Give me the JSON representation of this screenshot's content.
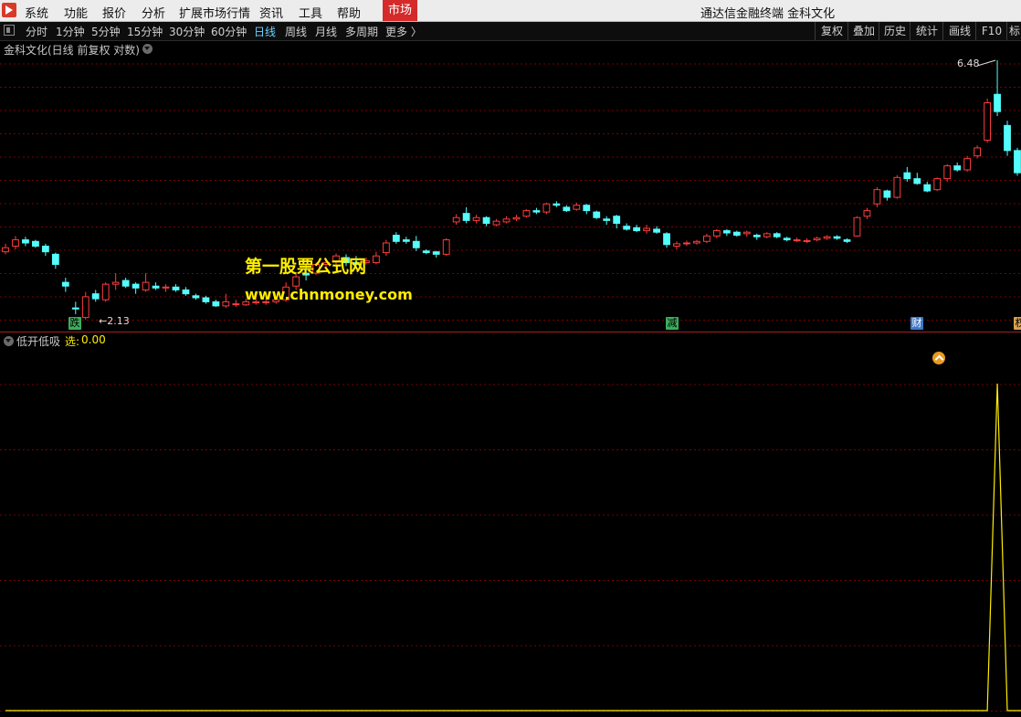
{
  "menu": {
    "items": [
      "系统",
      "功能",
      "报价",
      "分析",
      "扩展市场行情",
      "资讯",
      "工具",
      "帮助"
    ],
    "market_label": "市场",
    "window_title": "通达信金融终端 金科文化"
  },
  "toolbar": {
    "periods": [
      "分时",
      "1分钟",
      "5分钟",
      "15分钟",
      "30分钟",
      "60分钟",
      "日线",
      "周线",
      "月线",
      "多周期",
      "更多 〉"
    ],
    "active_period": "日线",
    "right_buttons": [
      "复权",
      "叠加",
      "历史",
      "统计",
      "画线",
      "F10",
      "标"
    ]
  },
  "chart": {
    "title": "金科文化(日线 前复权 对数)",
    "high_label": "6.48",
    "low_label": "←2.13",
    "event_tags": [
      "跌",
      "减",
      "财",
      "权"
    ],
    "watermark_line1": "第一股票公式网",
    "watermark_line2": "www.chnmoney.com",
    "colors": {
      "up": "#ff3c3c",
      "down": "#54fcfc",
      "grid": "#7a0000",
      "indicator": "#ffee00"
    }
  },
  "indicator": {
    "name": "低开低吸",
    "key": "选:",
    "value": "0.00"
  },
  "chart_data": {
    "type": "candlestick",
    "high": 6.48,
    "low": 2.13,
    "candles": [
      [
        2.85,
        2.9,
        2.82,
        2.95
      ],
      [
        2.92,
        3.0,
        2.88,
        3.05
      ],
      [
        3.0,
        2.96,
        2.92,
        3.04
      ],
      [
        2.98,
        2.92,
        2.9,
        3.0
      ],
      [
        2.92,
        2.85,
        2.8,
        2.95
      ],
      [
        2.82,
        2.7,
        2.65,
        2.84
      ],
      [
        2.5,
        2.46,
        2.4,
        2.55
      ],
      [
        2.24,
        2.23,
        2.18,
        2.3
      ],
      [
        2.15,
        2.35,
        2.13,
        2.4
      ],
      [
        2.38,
        2.33,
        2.3,
        2.42
      ],
      [
        2.32,
        2.48,
        2.3,
        2.5
      ],
      [
        2.48,
        2.5,
        2.42,
        2.6
      ],
      [
        2.52,
        2.46,
        2.44,
        2.55
      ],
      [
        2.48,
        2.44,
        2.38,
        2.5
      ],
      [
        2.42,
        2.5,
        2.4,
        2.6
      ],
      [
        2.46,
        2.44,
        2.42,
        2.5
      ],
      [
        2.44,
        2.45,
        2.4,
        2.48
      ],
      [
        2.45,
        2.42,
        2.4,
        2.48
      ],
      [
        2.42,
        2.38,
        2.36,
        2.45
      ],
      [
        2.36,
        2.34,
        2.32,
        2.38
      ],
      [
        2.34,
        2.3,
        2.28,
        2.36
      ],
      [
        2.3,
        2.26,
        2.25,
        2.32
      ],
      [
        2.26,
        2.3,
        2.24,
        2.38
      ],
      [
        2.28,
        2.28,
        2.25,
        2.32
      ],
      [
        2.27,
        2.3,
        2.26,
        2.33
      ],
      [
        2.29,
        2.3,
        2.27,
        2.34
      ],
      [
        2.3,
        2.3,
        2.27,
        2.34
      ],
      [
        2.3,
        2.32,
        2.28,
        2.35
      ],
      [
        2.32,
        2.45,
        2.3,
        2.5
      ],
      [
        2.46,
        2.56,
        2.42,
        2.6
      ],
      [
        2.6,
        2.58,
        2.52,
        2.7
      ],
      [
        2.6,
        2.7,
        2.58,
        2.72
      ],
      [
        2.7,
        2.72,
        2.65,
        2.76
      ],
      [
        2.74,
        2.8,
        2.7,
        2.83
      ],
      [
        2.78,
        2.72,
        2.68,
        2.82
      ],
      [
        2.72,
        2.7,
        2.66,
        2.8
      ],
      [
        2.72,
        2.74,
        2.7,
        2.78
      ],
      [
        2.72,
        2.8,
        2.7,
        2.85
      ],
      [
        2.84,
        2.96,
        2.8,
        3.0
      ],
      [
        3.06,
        2.98,
        2.95,
        3.1
      ],
      [
        3.0,
        2.98,
        2.95,
        3.04
      ],
      [
        2.98,
        2.9,
        2.86,
        3.05
      ],
      [
        2.86,
        2.84,
        2.82,
        2.88
      ],
      [
        2.85,
        2.82,
        2.78,
        2.86
      ],
      [
        2.82,
        3.0,
        2.8,
        3.02
      ],
      [
        3.24,
        3.3,
        3.2,
        3.35
      ],
      [
        3.36,
        3.26,
        3.22,
        3.45
      ],
      [
        3.26,
        3.3,
        3.22,
        3.34
      ],
      [
        3.3,
        3.22,
        3.18,
        3.32
      ],
      [
        3.2,
        3.25,
        3.18,
        3.28
      ],
      [
        3.24,
        3.28,
        3.22,
        3.32
      ],
      [
        3.28,
        3.3,
        3.25,
        3.34
      ],
      [
        3.32,
        3.4,
        3.3,
        3.42
      ],
      [
        3.4,
        3.38,
        3.35,
        3.44
      ],
      [
        3.38,
        3.5,
        3.35,
        3.52
      ],
      [
        3.5,
        3.48,
        3.45,
        3.54
      ],
      [
        3.45,
        3.4,
        3.38,
        3.48
      ],
      [
        3.42,
        3.48,
        3.4,
        3.52
      ],
      [
        3.48,
        3.4,
        3.35,
        3.5
      ],
      [
        3.38,
        3.3,
        3.28,
        3.4
      ],
      [
        3.28,
        3.26,
        3.2,
        3.32
      ],
      [
        3.32,
        3.22,
        3.15,
        3.34
      ],
      [
        3.18,
        3.14,
        3.12,
        3.22
      ],
      [
        3.16,
        3.12,
        3.1,
        3.2
      ],
      [
        3.12,
        3.15,
        3.08,
        3.2
      ],
      [
        3.14,
        3.1,
        3.08,
        3.18
      ],
      [
        3.08,
        2.94,
        2.9,
        3.1
      ],
      [
        2.92,
        2.95,
        2.88,
        2.98
      ],
      [
        2.95,
        2.96,
        2.92,
        2.99
      ],
      [
        2.96,
        2.98,
        2.94,
        3.0
      ],
      [
        2.98,
        3.05,
        2.96,
        3.08
      ],
      [
        3.05,
        3.12,
        3.02,
        3.14
      ],
      [
        3.12,
        3.09,
        3.05,
        3.14
      ],
      [
        3.1,
        3.06,
        3.04,
        3.12
      ],
      [
        3.08,
        3.1,
        3.04,
        3.12
      ],
      [
        3.06,
        3.04,
        3.0,
        3.08
      ],
      [
        3.04,
        3.08,
        3.02,
        3.1
      ],
      [
        3.08,
        3.04,
        3.02,
        3.1
      ],
      [
        3.02,
        3.0,
        2.98,
        3.04
      ],
      [
        3.0,
        3.0,
        2.97,
        3.03
      ],
      [
        2.99,
        2.99,
        2.96,
        3.02
      ],
      [
        3.0,
        3.02,
        2.98,
        3.04
      ],
      [
        3.02,
        3.04,
        3.0,
        3.06
      ],
      [
        3.04,
        3.02,
        3.0,
        3.06
      ],
      [
        3.0,
        2.98,
        2.96,
        3.02
      ],
      [
        3.05,
        3.3,
        3.04,
        3.32
      ],
      [
        3.32,
        3.4,
        3.28,
        3.44
      ],
      [
        3.5,
        3.72,
        3.45,
        3.76
      ],
      [
        3.7,
        3.6,
        3.55,
        3.72
      ],
      [
        3.6,
        3.92,
        3.58,
        3.96
      ],
      [
        4.0,
        3.9,
        3.85,
        4.1
      ],
      [
        3.9,
        3.82,
        3.8,
        4.0
      ],
      [
        3.8,
        3.7,
        3.68,
        3.85
      ],
      [
        3.72,
        3.9,
        3.7,
        3.92
      ],
      [
        3.9,
        4.12,
        3.85,
        4.15
      ],
      [
        4.12,
        4.05,
        4.02,
        4.18
      ],
      [
        4.05,
        4.25,
        4.02,
        4.3
      ],
      [
        4.3,
        4.45,
        4.25,
        4.5
      ],
      [
        4.6,
        5.4,
        4.55,
        5.5
      ],
      [
        5.6,
        5.2,
        5.1,
        6.48
      ],
      [
        4.9,
        4.4,
        4.3,
        5.0
      ],
      [
        4.4,
        4.0,
        3.95,
        4.45
      ]
    ],
    "indicator": {
      "name": "低开低吸",
      "series": [
        0,
        0,
        0,
        0,
        0,
        0,
        0,
        0,
        0,
        0,
        0,
        0,
        0,
        0,
        0,
        0,
        0,
        0,
        0,
        0,
        0,
        0,
        0,
        0,
        0,
        0,
        0,
        0,
        0,
        0,
        0,
        0,
        0,
        0,
        0,
        0,
        0,
        0,
        0,
        0,
        0,
        0,
        0,
        0,
        0,
        0,
        0,
        0,
        0,
        0,
        0,
        0,
        0,
        0,
        0,
        0,
        0,
        0,
        0,
        0,
        0,
        0,
        0,
        0,
        0,
        0,
        0,
        0,
        0,
        0,
        0,
        0,
        0,
        0,
        0,
        0,
        0,
        0,
        0,
        0,
        0,
        0,
        0,
        0,
        0,
        0,
        0,
        0,
        0,
        0,
        0,
        0,
        0,
        0,
        0,
        0,
        0,
        0,
        0,
        1,
        0,
        0,
        0
      ],
      "ylim": [
        0,
        1
      ],
      "current_value": 0.0
    }
  }
}
